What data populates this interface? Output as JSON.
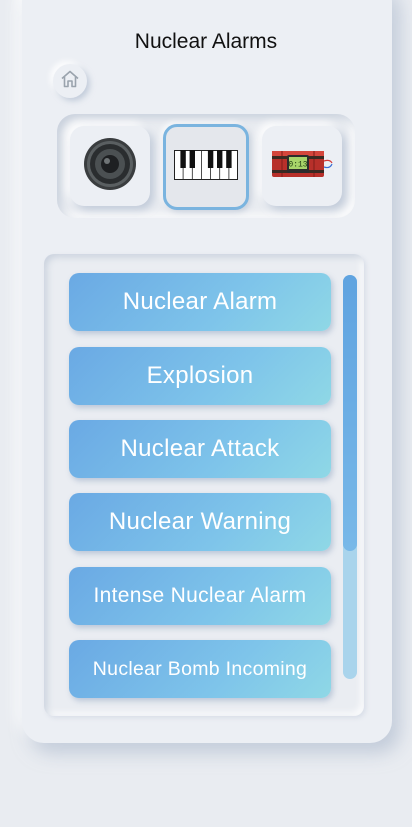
{
  "app": {
    "title": "Nuclear Alarms"
  },
  "sound_picker": {
    "items": [
      {
        "name": "speaker",
        "icon": "speaker-icon",
        "selected": false
      },
      {
        "name": "piano",
        "icon": "piano-keys-icon",
        "selected": true
      },
      {
        "name": "bomb",
        "icon": "time-bomb-icon",
        "selected": false
      }
    ],
    "bomb_timer_text": "0:13"
  },
  "alarms": [
    {
      "label": "Nuclear Alarm"
    },
    {
      "label": "Explosion"
    },
    {
      "label": "Nuclear Attack"
    },
    {
      "label": "Nuclear Warning"
    },
    {
      "label": "Intense Nuclear Alarm"
    },
    {
      "label": "Nuclear Bomb Incoming"
    }
  ],
  "colors": {
    "background": "#e9ecf1",
    "accent": "#6aa9e4",
    "accent_light": "#8fd8e6",
    "selected_border": "#7ab4df"
  },
  "scroll": {
    "position": 0.0,
    "visible_fraction": 0.68
  }
}
